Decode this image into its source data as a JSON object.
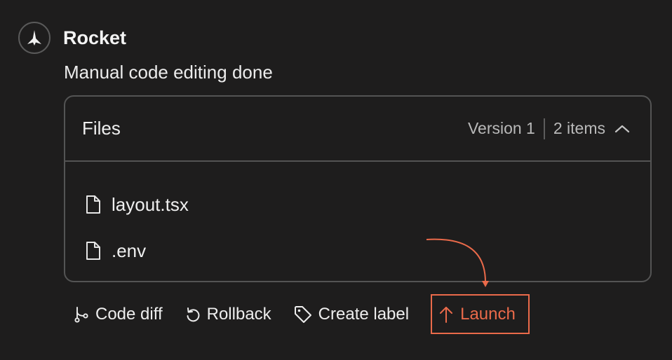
{
  "header": {
    "app_name": "Rocket",
    "logo_icon": "rocket-logo-icon"
  },
  "message": "Manual code editing done",
  "files_card": {
    "title": "Files",
    "version": "Version 1",
    "count": "2 items",
    "collapse_icon": "chevron-up-icon",
    "files": [
      {
        "name": "layout.tsx",
        "icon": "file-icon"
      },
      {
        "name": ".env",
        "icon": "file-icon"
      }
    ]
  },
  "actions": [
    {
      "label": "Code diff",
      "icon": "git-branch-icon"
    },
    {
      "label": "Rollback",
      "icon": "undo-icon"
    },
    {
      "label": "Create label",
      "icon": "tag-icon"
    },
    {
      "label": "Launch",
      "icon": "arrow-up-icon",
      "highlighted": true
    }
  ],
  "colors": {
    "background": "#1e1d1d",
    "border": "#545454",
    "accent": "#ea6a4a",
    "text": "#efefef",
    "muted": "#b9b9b9"
  }
}
